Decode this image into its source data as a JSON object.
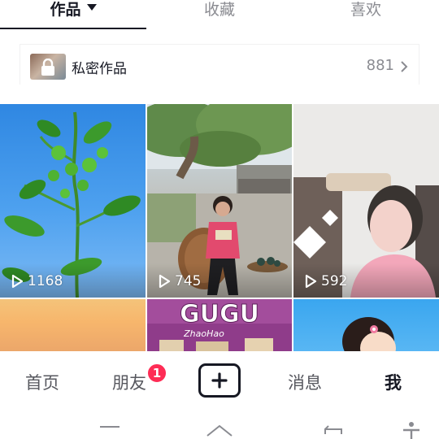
{
  "tabs": [
    {
      "label": "作品",
      "active": true
    },
    {
      "label": "收藏",
      "active": false
    },
    {
      "label": "喜欢",
      "active": false
    }
  ],
  "private_works": {
    "label": "私密作品",
    "count": "881",
    "icon": "lock-icon"
  },
  "videos": [
    {
      "views": "1168",
      "icon": "play-icon"
    },
    {
      "views": "745",
      "icon": "play-icon"
    },
    {
      "views": "592",
      "icon": "play-icon"
    }
  ],
  "snack_text": "GUGU",
  "snack_subtext": "ZhaoHao",
  "bottom_nav": {
    "home": "首页",
    "friends": "朋友",
    "friends_badge": "1",
    "add_icon": "plus-icon",
    "messages": "消息",
    "me": "我"
  },
  "system_nav": [
    "menu-icon",
    "home-icon",
    "back-icon",
    "accessibility-icon"
  ],
  "colors": {
    "badge": "#fe2c55",
    "text_primary": "#161823",
    "text_secondary": "#8a8b91"
  }
}
